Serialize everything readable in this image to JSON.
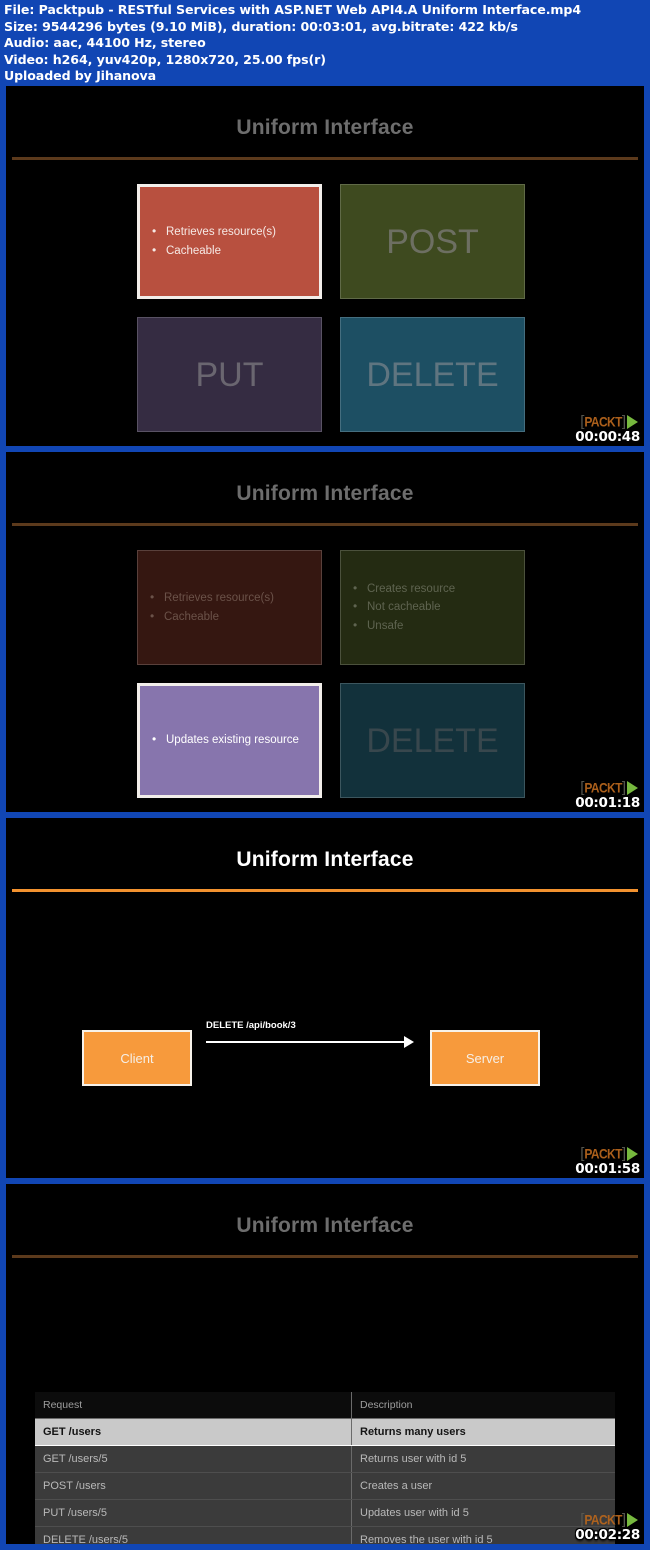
{
  "header": {
    "lines": [
      "File: Packtpub - RESTful Services with ASP.NET Web API4.A Uniform Interface.mp4",
      "Size: 9544296 bytes (9.10 MiB), duration: 00:03:01, avg.bitrate: 422 kb/s",
      "Audio: aac, 44100 Hz, stereo",
      "Video: h264, yuv420p, 1280x720, 25.00 fps(r)",
      "Uploaded by Jihanova"
    ]
  },
  "watermark": {
    "bracket_left": "[",
    "bracket_right": "]",
    "word": "PACKT"
  },
  "panels": [
    {
      "title": "Uniform Interface",
      "timestamp": "00:00:48",
      "state": "dim",
      "boxes": [
        {
          "name": "get",
          "highlighted": true,
          "word": "",
          "bullets": [
            "Retrieves resource(s)",
            "Cacheable"
          ],
          "fill": "#b8503f",
          "text": "#f6e9e5"
        },
        {
          "name": "post",
          "highlighted": false,
          "word": "POST",
          "bullets": [],
          "fill": "#3e4a1f",
          "text": "#6d6f62"
        },
        {
          "name": "put",
          "highlighted": false,
          "word": "PUT",
          "bullets": [],
          "fill": "#352c42",
          "text": "#6a6670"
        },
        {
          "name": "delete",
          "highlighted": false,
          "word": "DELETE",
          "bullets": [],
          "fill": "#1d4f63",
          "text": "#5f7580"
        }
      ]
    },
    {
      "title": "Uniform Interface",
      "timestamp": "00:01:18",
      "state": "dim",
      "boxes": [
        {
          "name": "get",
          "highlighted": false,
          "word": "",
          "bullets": [
            "Retrieves resource(s)",
            "Cacheable"
          ],
          "fill": "#351711",
          "text": "#6b5249"
        },
        {
          "name": "post",
          "highlighted": false,
          "word": "",
          "bullets": [
            "Creates resource",
            "Not cacheable",
            "Unsafe"
          ],
          "fill": "#242b12",
          "text": "#5f6450"
        },
        {
          "name": "put",
          "highlighted": true,
          "word": "",
          "bullets": [
            "Updates existing resource"
          ],
          "fill": "#8775ad",
          "text": "#ffffff"
        },
        {
          "name": "delete",
          "highlighted": false,
          "word": "DELETE",
          "bullets": [],
          "fill": "#12313b",
          "text": "#38474d"
        }
      ]
    },
    {
      "title": "Uniform Interface",
      "timestamp": "00:01:58",
      "state": "bright",
      "flow": {
        "client_label": "Client",
        "server_label": "Server",
        "request_label": "DELETE /api/book/3"
      }
    },
    {
      "title": "Uniform Interface",
      "timestamp": "00:02:28",
      "state": "dim",
      "table": {
        "columns": [
          "Request",
          "Description"
        ],
        "rows": [
          {
            "request": "GET /users",
            "description": "Returns many users",
            "highlighted": true
          },
          {
            "request": "GET /users/5",
            "description": "Returns user with id 5",
            "highlighted": false
          },
          {
            "request": "POST /users",
            "description": "Creates a user",
            "highlighted": false
          },
          {
            "request": "PUT /users/5",
            "description": "Updates user with id 5",
            "highlighted": false
          },
          {
            "request": "DELETE /users/5",
            "description": "Removes the user with id 5",
            "highlighted": false
          }
        ]
      }
    }
  ]
}
